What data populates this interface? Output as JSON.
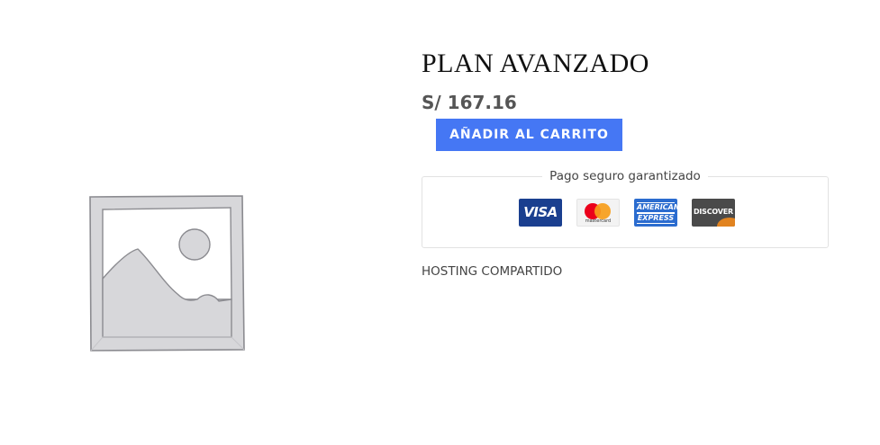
{
  "product": {
    "title": "PLAN AVANZADO",
    "price": "S/ 167.16",
    "add_to_cart_label": "AÑADIR AL CARRITO",
    "category": "HOSTING COMPARTIDO",
    "image_icon": "image-placeholder-icon"
  },
  "payment": {
    "heading": "Pago seguro garantizado",
    "cards": [
      {
        "name": "visa",
        "label": "VISA",
        "icon": "visa-card-icon",
        "color": "#1a3f8f"
      },
      {
        "name": "mastercard",
        "label": "mastercard",
        "icon": "mastercard-card-icon",
        "color": "#f3f3f3"
      },
      {
        "name": "amex",
        "label_line1": "AMERICAN",
        "label_line2": "EXPRESS",
        "icon": "amex-card-icon",
        "color": "#2b6ccf"
      },
      {
        "name": "discover",
        "label": "DISCOVER",
        "icon": "discover-card-icon",
        "color": "#4a4a4a"
      }
    ]
  },
  "colors": {
    "accent": "#4577f4",
    "placeholder": "#d6d6d9"
  }
}
